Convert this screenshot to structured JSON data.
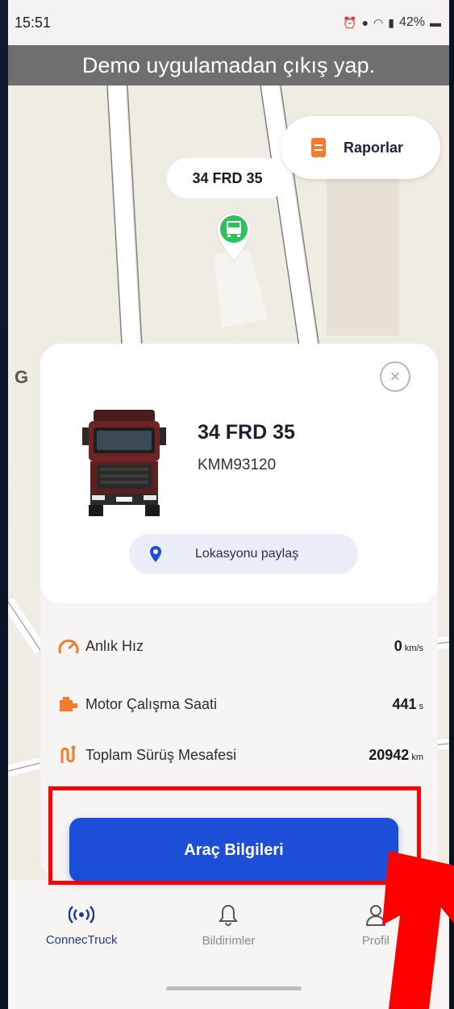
{
  "status_bar": {
    "time": "15:51",
    "battery": "42%"
  },
  "demo_banner": "Demo uygulamadan çıkış yap.",
  "map": {
    "reports_label": "Raporlar",
    "vehicle_plate_bubble": "34 FRD 35"
  },
  "vehicle_card": {
    "plate": "34 FRD 35",
    "vin": "KMM93120",
    "share_label": "Lokasyonu paylaş",
    "stats": [
      {
        "label": "Anlık Hız",
        "value": "0",
        "unit": "km/s"
      },
      {
        "label": "Motor Çalışma Saati",
        "value": "441",
        "unit": "s"
      },
      {
        "label": "Toplam Sürüş Mesafesi",
        "value": "20942",
        "unit": "km"
      }
    ],
    "action_label": "Araç Bilgileri"
  },
  "bottom_nav": [
    {
      "label": "ConnecTruck",
      "icon": "radio-waves-icon",
      "active": true
    },
    {
      "label": "Bildirimler",
      "icon": "bell-icon",
      "active": false
    },
    {
      "label": "Profil",
      "icon": "user-icon",
      "active": false
    }
  ],
  "colors": {
    "accent": "#1d4ed8",
    "orange": "#f07d2e",
    "highlight": "#ff0000"
  }
}
